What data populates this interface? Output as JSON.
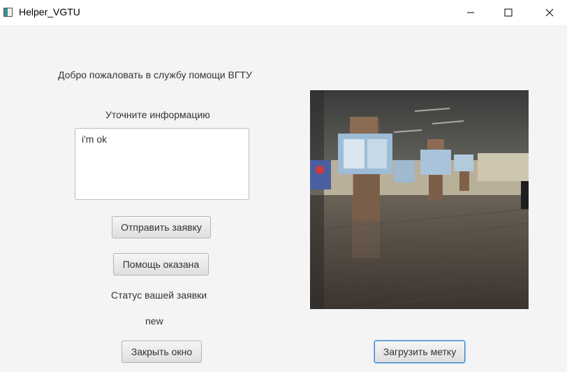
{
  "window": {
    "title": "Helper_VGTU",
    "controls": {
      "minimize": "—",
      "maximize": "☐",
      "close": "✕"
    }
  },
  "main": {
    "welcome_text": "Добро пожаловать в службу помощи ВГТУ",
    "clarify_label": "Уточните информацию",
    "request_text": "i'm ok",
    "send_button": "Отправить заявку",
    "help_given_button": "Помощь оказана",
    "status_label": "Статус вашей заявки",
    "status_value": "new",
    "close_button": "Закрыть окно",
    "upload_button": "Загрузить метку"
  },
  "colors": {
    "accent": "#3f8ac9",
    "background": "#f4f4f4"
  }
}
